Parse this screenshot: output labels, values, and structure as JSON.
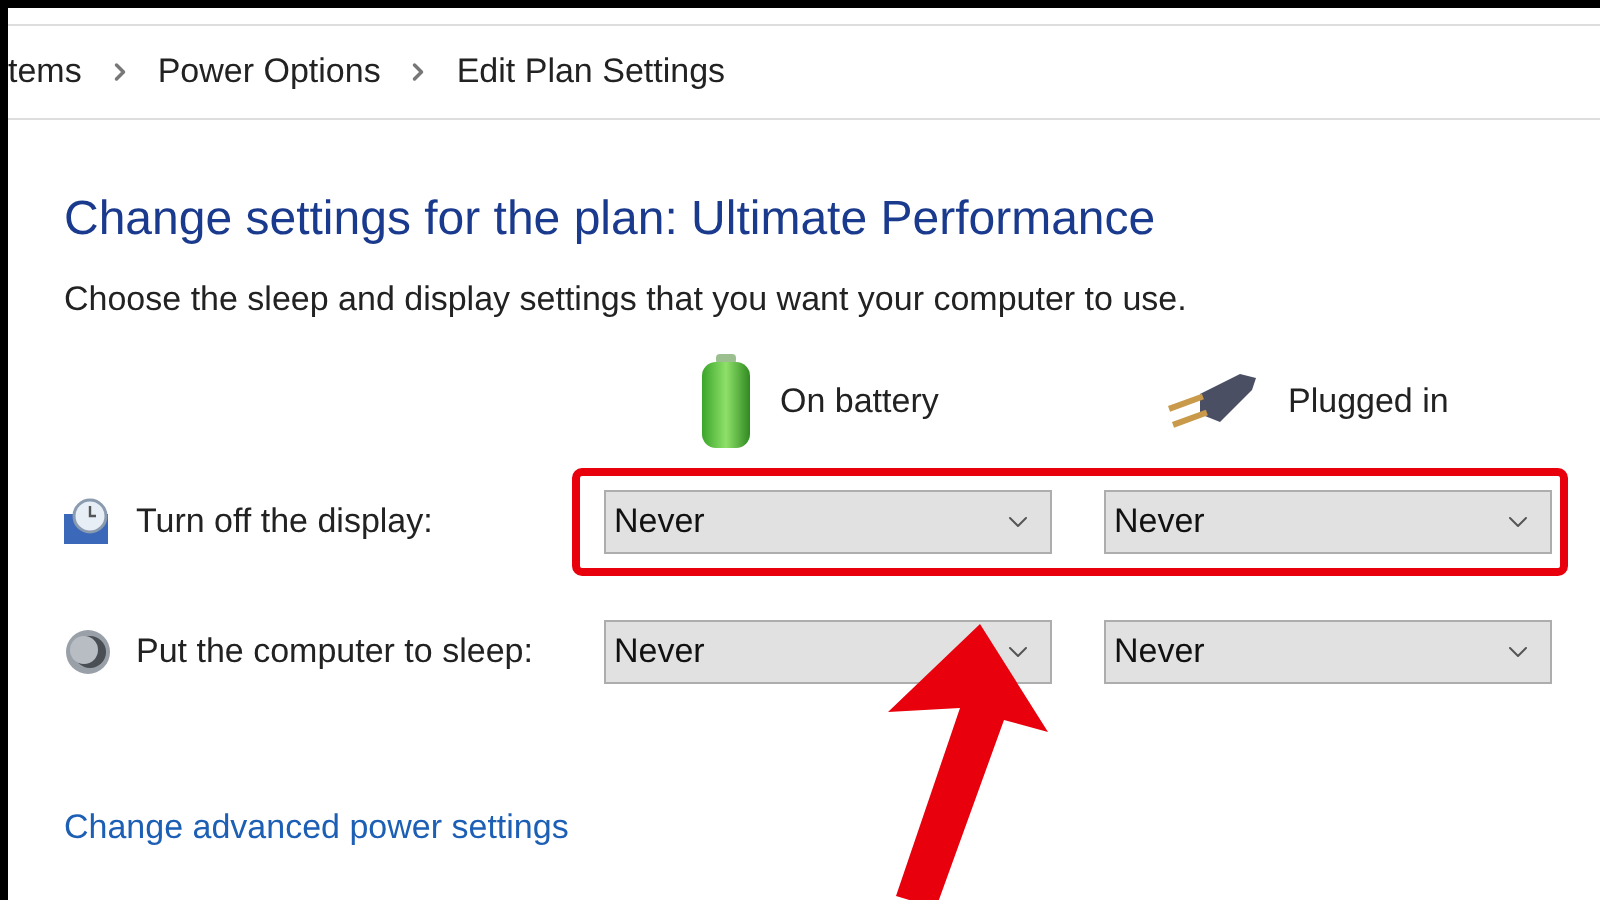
{
  "breadcrumb": [
    {
      "label": "tems"
    },
    {
      "label": "Power Options"
    },
    {
      "label": "Edit Plan Settings"
    }
  ],
  "title": "Change settings for the plan: Ultimate Performance",
  "description": "Choose the sleep and display settings that you want your computer to use.",
  "columns": [
    {
      "kind": "battery",
      "label": "On battery"
    },
    {
      "kind": "plug",
      "label": "Plugged in"
    }
  ],
  "settings": [
    {
      "kind": "display",
      "label": "Turn off the display:",
      "highlighted": true,
      "values": [
        "Never",
        "Never"
      ]
    },
    {
      "kind": "sleep",
      "label": "Put the computer to sleep:",
      "highlighted": false,
      "values": [
        "Never",
        "Never"
      ]
    }
  ],
  "link": "Change advanced power settings"
}
